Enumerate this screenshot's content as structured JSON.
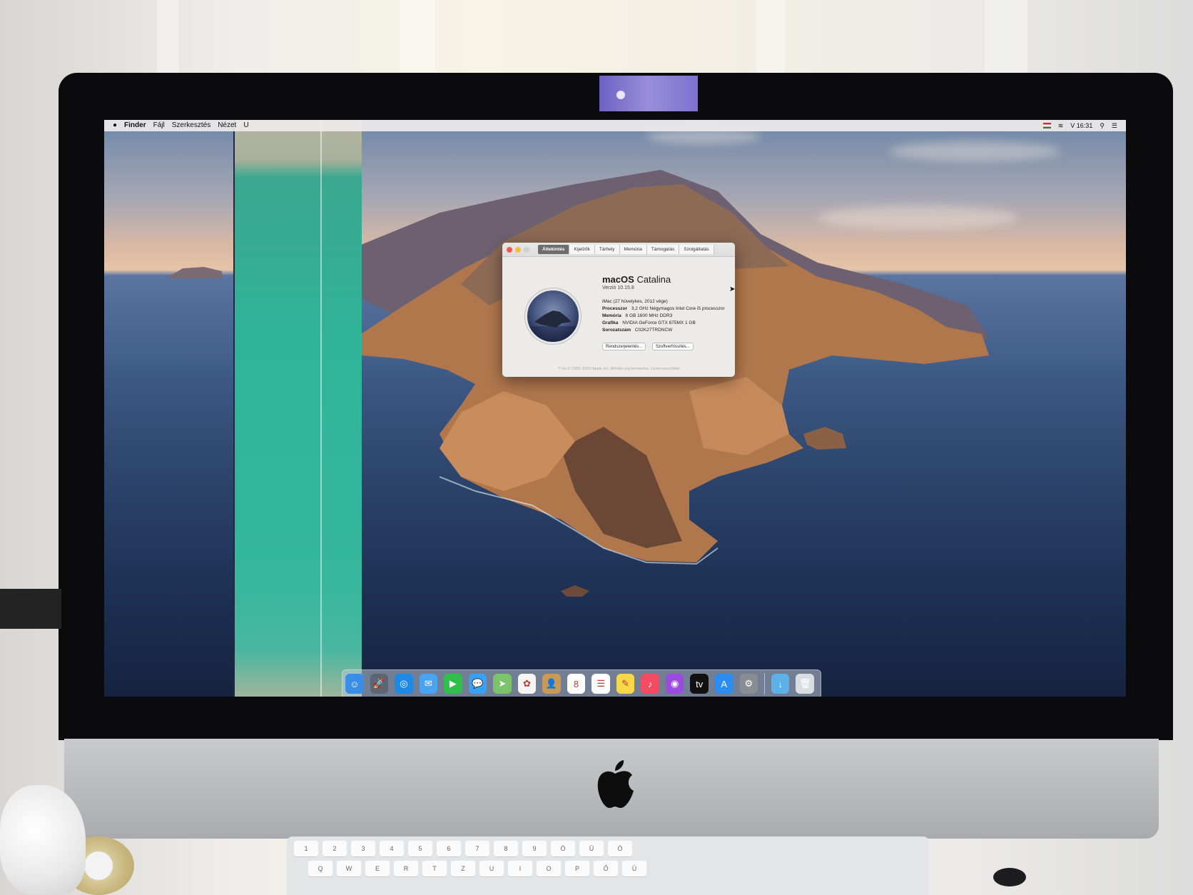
{
  "menubar": {
    "apple": "",
    "app_name": "Finder",
    "menus": [
      "Fájl",
      "Szerkesztés",
      "Nézet",
      "U"
    ],
    "clock": "V 16:31"
  },
  "about_window": {
    "tabs": [
      "Áttekintés",
      "Kijelzők",
      "Tárhely",
      "Memória",
      "Támogatás",
      "Szolgáltatás"
    ],
    "active_tab": "Áttekintés",
    "os_name_bold": "macOS",
    "os_name_light": "Catalina",
    "version": "Verzió 10.15.8",
    "model": "iMac (27 hüvelykes, 2012 vége)",
    "specs": [
      {
        "label": "Processzor",
        "value": "3,2 GHz Négymagos Intel Core i5 processzor"
      },
      {
        "label": "Memória",
        "value": "8 GB 1600 MHz DDR3"
      },
      {
        "label": "Grafika",
        "value": "NVIDIA GeForce GTX 675MX 1 GB"
      },
      {
        "label": "Sorozatszám",
        "value": "C02K27TRDNCW"
      }
    ],
    "buttons": {
      "system_report": "Rendszerjelentés...",
      "software_update": "Szoftverfrissítés..."
    },
    "footer": "™ és © 1983–2020 Apple Inc. Minden jog fenntartva. Licencszerződés"
  },
  "dock": {
    "apps": [
      {
        "name": "Finder",
        "icon": "finder-icon",
        "color": "#3a8ee6",
        "glyph": "☺"
      },
      {
        "name": "Launchpad",
        "icon": "launchpad-icon",
        "color": "#5d6670",
        "glyph": "🚀"
      },
      {
        "name": "Safari",
        "icon": "safari-icon",
        "color": "#1e88e5",
        "glyph": "◎"
      },
      {
        "name": "Mail",
        "icon": "mail-icon",
        "color": "#4aa3f0",
        "glyph": "✉"
      },
      {
        "name": "FaceTime",
        "icon": "facetime-icon",
        "color": "#2fbf4a",
        "glyph": "▶"
      },
      {
        "name": "Messages",
        "icon": "messages-icon",
        "color": "#3aa0f4",
        "glyph": "💬"
      },
      {
        "name": "Maps",
        "icon": "maps-icon",
        "color": "#7cc46b",
        "glyph": "➤"
      },
      {
        "name": "Photos",
        "icon": "photos-icon",
        "color": "#f5f5f5",
        "glyph": "✿"
      },
      {
        "name": "Contacts",
        "icon": "contacts-icon",
        "color": "#c99a55",
        "glyph": "👤"
      },
      {
        "name": "Calendar",
        "icon": "calendar-icon",
        "color": "#ffffff",
        "glyph": "8"
      },
      {
        "name": "Reminders",
        "icon": "reminders-icon",
        "color": "#ffffff",
        "glyph": "☰"
      },
      {
        "name": "Notes",
        "icon": "notes-icon",
        "color": "#f6d84a",
        "glyph": "✎"
      },
      {
        "name": "Music",
        "icon": "music-icon",
        "color": "#f24b62",
        "glyph": "♪"
      },
      {
        "name": "Podcasts",
        "icon": "podcasts-icon",
        "color": "#9b4be0",
        "glyph": "◉"
      },
      {
        "name": "TV",
        "icon": "tv-icon",
        "color": "#111111",
        "glyph": "tv"
      },
      {
        "name": "App Store",
        "icon": "app-store-icon",
        "color": "#2d8cf0",
        "glyph": "A"
      },
      {
        "name": "System Preferences",
        "icon": "system-preferences-icon",
        "color": "#8a8d91",
        "glyph": "⚙"
      }
    ],
    "extras": [
      {
        "name": "Downloads",
        "icon": "downloads-folder-icon",
        "color": "#5db0e8",
        "glyph": "↓"
      },
      {
        "name": "Trash",
        "icon": "trash-icon",
        "color": "#d9dde2",
        "glyph": "🗑"
      }
    ]
  },
  "keyboard": {
    "keys_row1": [
      "1",
      "2",
      "3",
      "4",
      "5",
      "6",
      "7",
      "8",
      "9",
      "Ö",
      "Ü",
      "Ó"
    ],
    "keys_row2": [
      "Q",
      "W",
      "E",
      "R",
      "T",
      "Z",
      "U",
      "I",
      "O",
      "P",
      "Ő",
      "Ú"
    ]
  }
}
